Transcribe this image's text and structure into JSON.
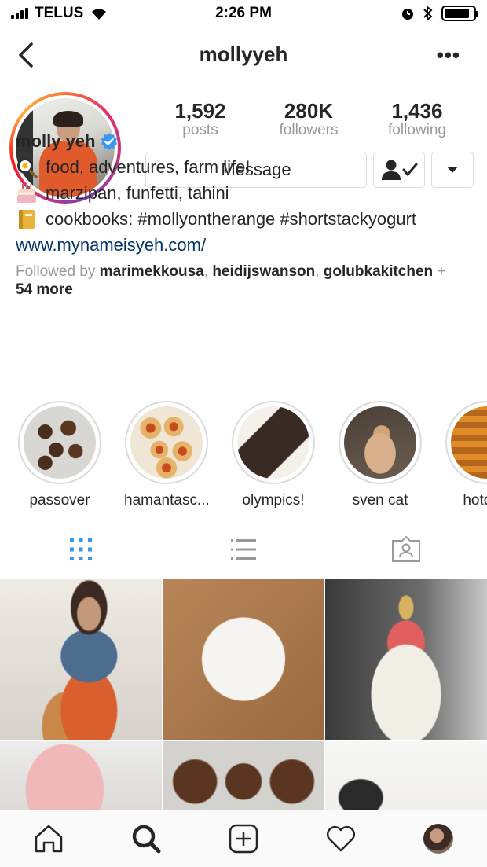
{
  "status_bar": {
    "carrier": "TELUS",
    "time": "2:26 PM",
    "signal_bars": 4,
    "battery_level": 0.85,
    "icons": [
      "signal-icon",
      "wifi-icon",
      "alarm-icon",
      "bluetooth-icon",
      "battery-icon"
    ]
  },
  "nav": {
    "title": "mollyyeh",
    "back_icon": "chevron-left-icon",
    "more_label": "•••"
  },
  "profile": {
    "stats": [
      {
        "value": "1,592",
        "label": "posts"
      },
      {
        "value": "280K",
        "label": "followers"
      },
      {
        "value": "1,436",
        "label": "following"
      }
    ],
    "message_label": "Message",
    "follow_icon": "following-check-icon",
    "dropdown_icon": "caret-down-icon"
  },
  "bio": {
    "name": "molly yeh",
    "verified": true,
    "lines": [
      {
        "emoji": "frying-pan-egg-icon",
        "text": "food, adventures, farm life!"
      },
      {
        "emoji": "birthday-cake-icon",
        "text": "marzipan, funfetti, tahini"
      },
      {
        "emoji": "notebook-icon",
        "text": "cookbooks: #mollyontherange #shortstackyogurt"
      }
    ],
    "link": "www.mynameisyeh.com/",
    "followed_by_prefix": "Followed by",
    "followed_by": [
      "marimekkousa",
      "heidijswanson",
      "golubkakitchen"
    ],
    "followed_more_plus": "+",
    "followed_more": "54 more"
  },
  "highlights": [
    {
      "label": "passover"
    },
    {
      "label": "hamantasc..."
    },
    {
      "label": "olympics!"
    },
    {
      "label": "sven cat"
    },
    {
      "label": "hotdish"
    }
  ],
  "tabs": [
    {
      "name": "grid",
      "icon": "grid-icon",
      "active": true
    },
    {
      "name": "list",
      "icon": "list-icon",
      "active": false
    },
    {
      "name": "tagged",
      "icon": "tagged-person-icon",
      "active": false
    }
  ],
  "bottom_nav": [
    {
      "name": "home",
      "icon": "home-icon"
    },
    {
      "name": "search",
      "icon": "search-icon",
      "active": true
    },
    {
      "name": "new-post",
      "icon": "plus-square-icon"
    },
    {
      "name": "activity",
      "icon": "heart-icon"
    },
    {
      "name": "profile",
      "icon": "profile-avatar-icon"
    }
  ],
  "colors": {
    "accent_blue": "#3897f0",
    "link_blue": "#003569",
    "gray_text": "#999999",
    "border": "#dbdbdb"
  }
}
